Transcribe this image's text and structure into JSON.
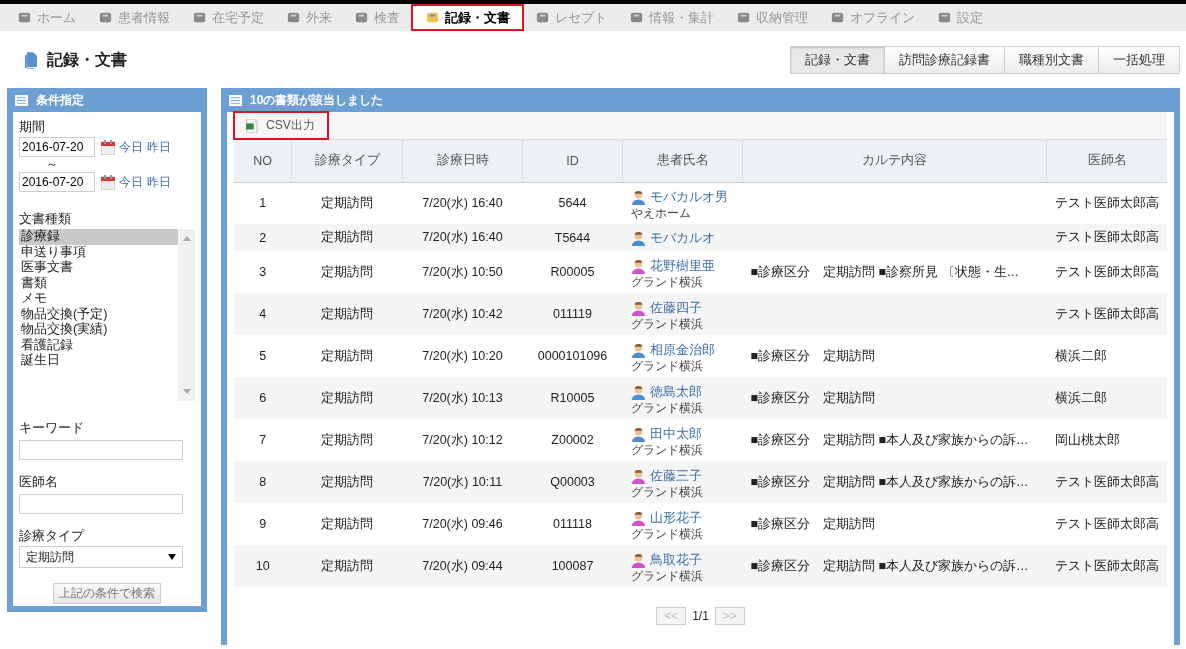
{
  "nav": [
    {
      "label": "ホーム",
      "selected": false
    },
    {
      "label": "患者情報",
      "selected": false
    },
    {
      "label": "在宅予定",
      "selected": false
    },
    {
      "label": "外来",
      "selected": false
    },
    {
      "label": "検査",
      "selected": false
    },
    {
      "label": "記録・文書",
      "selected": true
    },
    {
      "label": "レセプト",
      "selected": false
    },
    {
      "label": "情報・集計",
      "selected": false
    },
    {
      "label": "収納管理",
      "selected": false
    },
    {
      "label": "オフライン",
      "selected": false
    },
    {
      "label": "設定",
      "selected": false
    }
  ],
  "page_title": "記録・文書",
  "view_tabs": [
    {
      "label": "記録・文書",
      "selected": true
    },
    {
      "label": "訪問診療記録書",
      "selected": false
    },
    {
      "label": "職種別文書",
      "selected": false
    },
    {
      "label": "一括処理",
      "selected": false
    }
  ],
  "filter": {
    "title": "条件指定",
    "period_label": "期間",
    "date_from": {
      "value": "2016-07-20",
      "today": "今日",
      "yesterday": "昨日"
    },
    "tilde": "～",
    "date_to": {
      "value": "2016-07-20",
      "today": "今日",
      "yesterday": "昨日"
    },
    "doc_type_label": "文書種類",
    "doc_types": [
      {
        "label": "診療録",
        "selected": true
      },
      {
        "label": "申送り事項",
        "selected": false
      },
      {
        "label": "医事文書",
        "selected": false
      },
      {
        "label": "書類",
        "selected": false
      },
      {
        "label": "メモ",
        "selected": false
      },
      {
        "label": "物品交換(予定)",
        "selected": false
      },
      {
        "label": "物品交換(実績)",
        "selected": false
      },
      {
        "label": "看護記録",
        "selected": false
      },
      {
        "label": "誕生日",
        "selected": false
      }
    ],
    "keyword_label": "キーワード",
    "doctor_label": "医師名",
    "type_label": "診療タイプ",
    "type_value": "定期訪問",
    "search_button": "上記の条件で検索"
  },
  "results": {
    "title": "10の書類が該当しました",
    "csv_button": "CSV出力",
    "columns": [
      "NO",
      "診療タイプ",
      "診療日時",
      "ID",
      "患者氏名",
      "カルテ内容",
      "医師名"
    ],
    "rows": [
      {
        "no": "1",
        "type": "定期訪問",
        "datetime": "7/20(水) 16:40",
        "id": "5644",
        "patient": "モバカルオ男",
        "color": "#4a8fd6",
        "facility": "やえホーム",
        "content": "",
        "doctor": "テスト医師太郎高"
      },
      {
        "no": "2",
        "type": "定期訪問",
        "datetime": "7/20(水) 16:40",
        "id": "T5644",
        "patient": "モバカルオ",
        "color": "#4a8fd6",
        "facility": "",
        "content": "",
        "doctor": "テスト医師太郎高"
      },
      {
        "no": "3",
        "type": "定期訪問",
        "datetime": "7/20(水) 10:50",
        "id": "R00005",
        "patient": "花野樹里亜",
        "color": "#d24fd0",
        "facility": "グランド横浜",
        "content": "■診療区分　定期訪問 ■診察所見 〔状態・生…",
        "doctor": "テスト医師太郎高"
      },
      {
        "no": "4",
        "type": "定期訪問",
        "datetime": "7/20(水) 10:42",
        "id": "011119",
        "patient": "佐藤四子",
        "color": "#d24fd0",
        "facility": "グランド横浜",
        "content": "",
        "doctor": "テスト医師太郎高"
      },
      {
        "no": "5",
        "type": "定期訪問",
        "datetime": "7/20(水) 10:20",
        "id": "0000101096",
        "patient": "相原金治郎",
        "color": "#4a8fd6",
        "facility": "グランド横浜",
        "content": "■診療区分　定期訪問",
        "doctor": "横浜二郎"
      },
      {
        "no": "6",
        "type": "定期訪問",
        "datetime": "7/20(水) 10:13",
        "id": "R10005",
        "patient": "徳島太郎",
        "color": "#4a8fd6",
        "facility": "グランド横浜",
        "content": "■診療区分　定期訪問",
        "doctor": "横浜二郎"
      },
      {
        "no": "7",
        "type": "定期訪問",
        "datetime": "7/20(水) 10:12",
        "id": "Z00002",
        "patient": "田中太郎",
        "color": "#4a8fd6",
        "facility": "グランド横浜",
        "content": "■診療区分　定期訪問 ■本人及び家族からの訴…",
        "doctor": "岡山桃太郎"
      },
      {
        "no": "8",
        "type": "定期訪問",
        "datetime": "7/20(水) 10:11",
        "id": "Q00003",
        "patient": "佐藤三子",
        "color": "#d24fd0",
        "facility": "グランド横浜",
        "content": "■診療区分　定期訪問 ■本人及び家族からの訴…",
        "doctor": "テスト医師太郎高"
      },
      {
        "no": "9",
        "type": "定期訪問",
        "datetime": "7/20(水) 09:46",
        "id": "011118",
        "patient": "山形花子",
        "color": "#d24fd0",
        "facility": "グランド横浜",
        "content": "■診療区分　定期訪問",
        "doctor": "テスト医師太郎高"
      },
      {
        "no": "10",
        "type": "定期訪問",
        "datetime": "7/20(水) 09:44",
        "id": "100087",
        "patient": "鳥取花子",
        "color": "#d24fd0",
        "facility": "グランド横浜",
        "content": "■診療区分　定期訪問 ■本人及び家族からの訴…",
        "doctor": "テスト医師太郎高"
      }
    ],
    "pager": {
      "prev": "<<",
      "page": "1/1",
      "next": ">>"
    }
  }
}
